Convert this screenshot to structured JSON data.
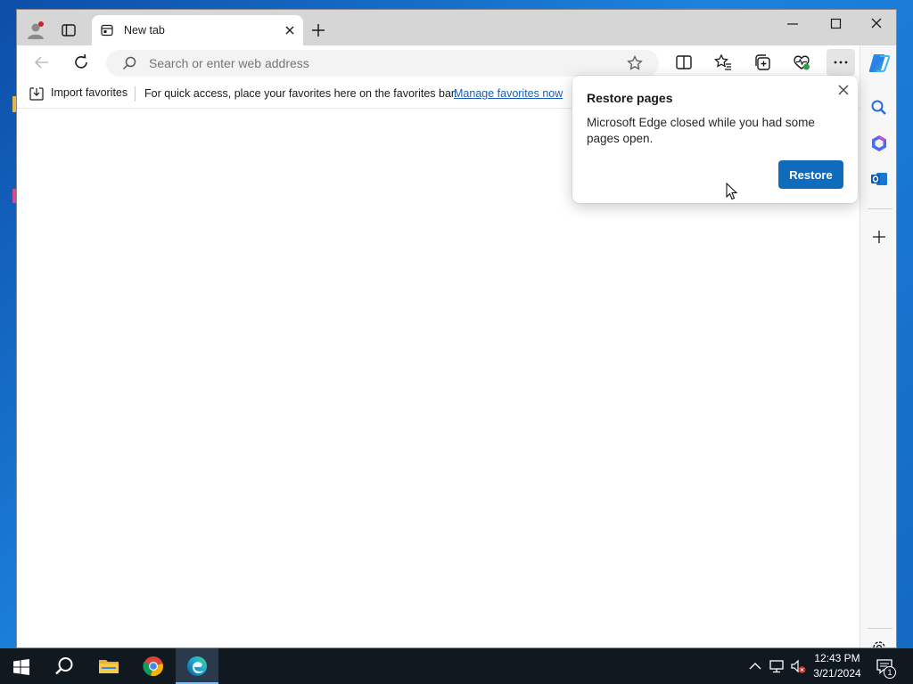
{
  "window": {
    "tab": {
      "title": "New tab"
    }
  },
  "toolbar": {
    "address_placeholder": "Search or enter web address"
  },
  "favorites_bar": {
    "import_label": "Import favorites",
    "message": "For quick access, place your favorites here on the favorites bar.",
    "link_label": "Manage favorites now"
  },
  "restore_popup": {
    "title": "Restore pages",
    "message": "Microsoft Edge closed while you had some pages open.",
    "button_label": "Restore"
  },
  "taskbar": {
    "time": "12:43 PM",
    "date": "3/21/2024",
    "notification_count": "1"
  },
  "colors": {
    "accent": "#0f6cbd",
    "link": "#1a5fb4",
    "taskbar": "#101820"
  },
  "icons": [
    "profile-icon",
    "tab-actions-icon",
    "newtab-page-icon",
    "close-icon",
    "plus-icon",
    "minimize-icon",
    "maximize-icon",
    "back-icon",
    "refresh-icon",
    "search-icon",
    "star-icon",
    "split-screen-icon",
    "favorites-icon",
    "collections-icon",
    "browser-essentials-icon",
    "more-icon",
    "copilot-icon",
    "sidebar-search-icon",
    "sidebar-office-icon",
    "sidebar-outlook-icon",
    "settings-icon",
    "start-icon",
    "chrome-icon",
    "edge-icon",
    "file-explorer-icon",
    "network-icon",
    "volume-icon",
    "notification-icon"
  ]
}
